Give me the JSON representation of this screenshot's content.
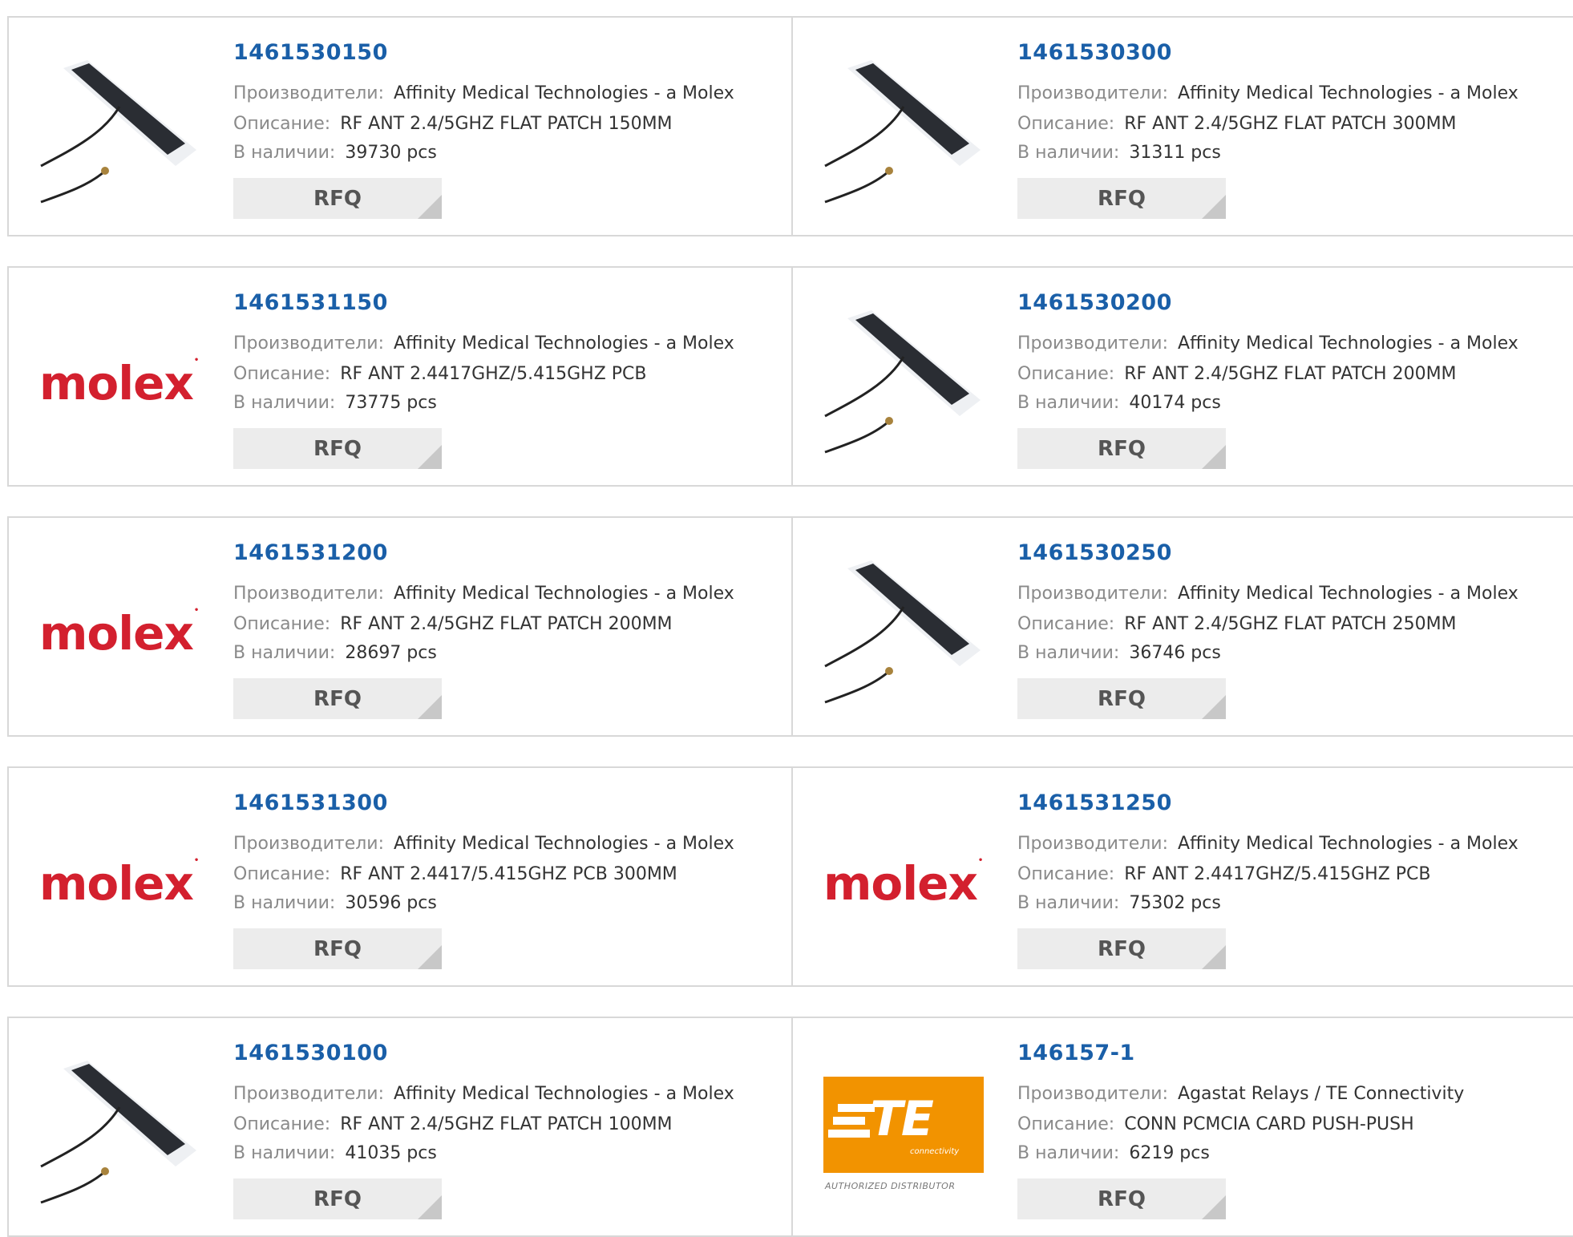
{
  "labels": {
    "manufacturer": "Производители:",
    "description": "Описание:",
    "stock": "В наличии:",
    "rfq": "RFQ"
  },
  "cards": [
    {
      "pn": "1461530150",
      "manufacturer": "Affinity Medical Technologies - a Molex",
      "description": "RF ANT 2.4/5GHZ FLAT PATCH 150MM",
      "stock": "39730 pcs",
      "image": "antenna-photo"
    },
    {
      "pn": "1461530300",
      "manufacturer": "Affinity Medical Technologies - a Molex",
      "description": "RF ANT 2.4/5GHZ FLAT PATCH 300MM",
      "stock": "31311 pcs",
      "image": "antenna-photo"
    },
    {
      "pn": "1461531150",
      "manufacturer": "Affinity Medical Technologies - a Molex",
      "description": "RF ANT 2.4417GHZ/5.415GHZ PCB",
      "stock": "73775 pcs",
      "image": "molex-logo"
    },
    {
      "pn": "1461530200",
      "manufacturer": "Affinity Medical Technologies - a Molex",
      "description": "RF ANT 2.4/5GHZ FLAT PATCH 200MM",
      "stock": "40174 pcs",
      "image": "antenna-photo"
    },
    {
      "pn": "1461531200",
      "manufacturer": "Affinity Medical Technologies - a Molex",
      "description": "RF ANT 2.4/5GHZ FLAT PATCH 200MM",
      "stock": "28697 pcs",
      "image": "molex-logo"
    },
    {
      "pn": "1461530250",
      "manufacturer": "Affinity Medical Technologies - a Molex",
      "description": "RF ANT 2.4/5GHZ FLAT PATCH 250MM",
      "stock": "36746 pcs",
      "image": "antenna-photo"
    },
    {
      "pn": "1461531300",
      "manufacturer": "Affinity Medical Technologies - a Molex",
      "description": "RF ANT 2.4417/5.415GHZ PCB 300MM",
      "stock": "30596 pcs",
      "image": "molex-logo"
    },
    {
      "pn": "1461531250",
      "manufacturer": "Affinity Medical Technologies - a Molex",
      "description": "RF ANT 2.4417GHZ/5.415GHZ PCB",
      "stock": "75302 pcs",
      "image": "molex-logo"
    },
    {
      "pn": "1461530100",
      "manufacturer": "Affinity Medical Technologies - a Molex",
      "description": "RF ANT 2.4/5GHZ FLAT PATCH 100MM",
      "stock": "41035 pcs",
      "image": "antenna-photo"
    },
    {
      "pn": "146157-1",
      "manufacturer": "Agastat Relays / TE Connectivity",
      "description": "CONN PCMCIA CARD PUSH-PUSH",
      "stock": "6219 pcs",
      "image": "te-logo"
    }
  ],
  "logos": {
    "molex": "molex",
    "te": "TE",
    "te_sub": "connectivity",
    "te_distributor": "AUTHORIZED DISTRIBUTOR"
  },
  "colors": {
    "link": "#1a5fa8",
    "molex": "#d3202e",
    "te": "#f29300",
    "button_bg": "#ececec"
  }
}
